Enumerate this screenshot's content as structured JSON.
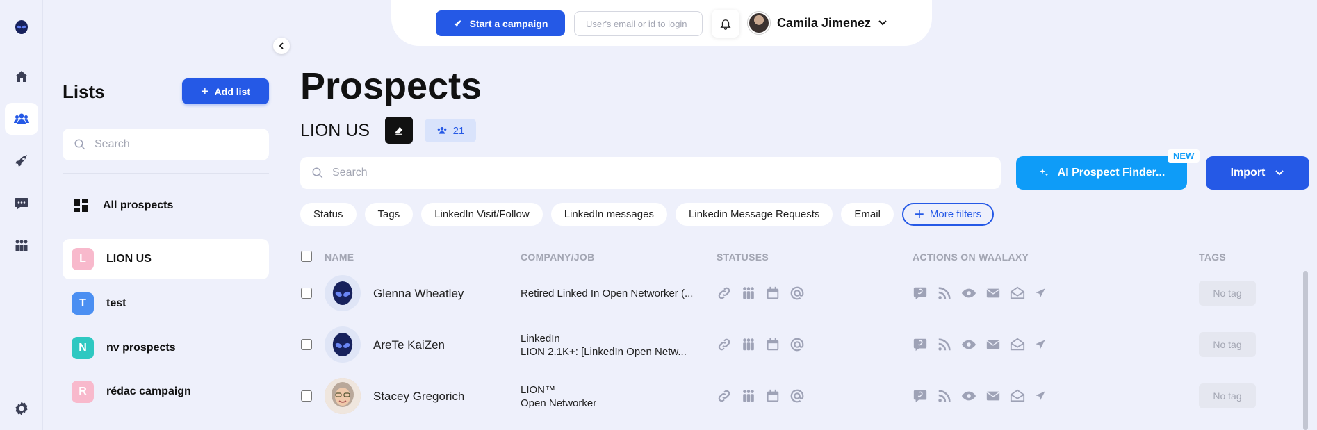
{
  "lists_panel": {
    "title": "Lists",
    "add_list_label": "Add list",
    "search_placeholder": "Search",
    "all_prospects_label": "All prospects",
    "items": [
      {
        "letter": "L",
        "name": "LION US",
        "color": "#f8b9cc",
        "active": true
      },
      {
        "letter": "T",
        "name": "test",
        "color": "#4b8ff2"
      },
      {
        "letter": "N",
        "name": "nv prospects",
        "color": "#2ec8c1"
      },
      {
        "letter": "R",
        "name": "rédac campaign",
        "color": "#f8b9cc"
      }
    ]
  },
  "topbar": {
    "campaign_label": "Start a campaign",
    "login_placeholder": "User's email or id to login",
    "user_name": "Camila Jimenez"
  },
  "main": {
    "title": "Prospects",
    "list_name": "LION US",
    "prospect_count": "21",
    "search_placeholder": "Search",
    "ai_label": "AI Prospect Finder...",
    "new_badge": "NEW",
    "import_label": "Import",
    "filters": [
      "Status",
      "Tags",
      "LinkedIn Visit/Follow",
      "LinkedIn messages",
      "Linkedin Message Requests",
      "Email"
    ],
    "more_filters_label": "More filters",
    "columns": {
      "name": "NAME",
      "company": "COMPANY/JOB",
      "statuses": "STATUSES",
      "actions": "ACTIONS ON WAALAXY",
      "tags": "TAGS"
    },
    "rows": [
      {
        "name": "Glenna Wheatley",
        "company_line1": "Retired Linked In Open Networker (...",
        "company_line2": "",
        "tag": "No tag",
        "avatar": "alien"
      },
      {
        "name": "AreTe KaiZen",
        "company_line1": "LinkedIn",
        "company_line2": "LION 2.1K+: [LinkedIn Open Netw...",
        "tag": "No tag",
        "avatar": "alien"
      },
      {
        "name": "Stacey Gregorich",
        "company_line1": "LION™",
        "company_line2": "Open Networker",
        "tag": "No tag",
        "avatar": "photo"
      }
    ]
  },
  "icons": {
    "rail": [
      "alien-logo-icon",
      "home-icon",
      "users-icon",
      "rocket-icon",
      "chat-icon",
      "team-icon",
      "gear-icon"
    ],
    "statuses": [
      "link-icon",
      "people-icon",
      "calendar-icon",
      "at-icon"
    ],
    "actions": [
      "linkedin-message-icon",
      "follow-rss-icon",
      "visit-eye-icon",
      "email-icon",
      "email-open-icon",
      "send-icon"
    ]
  },
  "colors": {
    "primary": "#2559e6",
    "ai_blue": "#0e9cf8",
    "background": "#eef0fb",
    "icon_gray": "#9ea2b6"
  }
}
